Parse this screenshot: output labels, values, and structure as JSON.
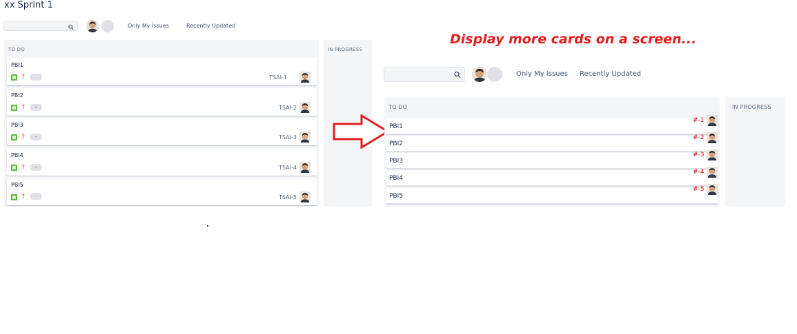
{
  "board": {
    "title": "xx Sprint 1"
  },
  "left_panel": {
    "search": {
      "value": "",
      "placeholder": ""
    },
    "filters": {
      "only_my_issues": "Only My Issues",
      "recently_updated": "Recently Updated"
    },
    "columns": {
      "todo": "TO DO",
      "in_progress": "IN PROGRESS"
    },
    "cards": [
      {
        "title": "PBI1",
        "estimate": "",
        "key": "TSAI-1"
      },
      {
        "title": "PBI2",
        "estimate": "-",
        "key": "TSAI-2"
      },
      {
        "title": "PBI3",
        "estimate": "-",
        "key": "TSAI-3"
      },
      {
        "title": "PBI4",
        "estimate": "-",
        "key": "TSAI-4"
      },
      {
        "title": "PBI5",
        "estimate": "",
        "key": "TSAI-5"
      }
    ]
  },
  "annotation": {
    "text": "Display more cards on a screen...",
    "arrow_color": "#e02020"
  },
  "right_panel": {
    "search": {
      "value": "",
      "placeholder": ""
    },
    "filters": {
      "only_my_issues": "Only My Issues",
      "recently_updated": "Recently Updated"
    },
    "columns": {
      "todo": "TO DO",
      "in_progress": "IN PROGRESS"
    },
    "cards": [
      {
        "title": "PBI1",
        "key": "#-1"
      },
      {
        "title": "PBI2",
        "key": "#-2"
      },
      {
        "title": "PBI3",
        "key": "#-3"
      },
      {
        "title": "PBI4",
        "key": "#-4"
      },
      {
        "title": "PBI5",
        "key": "#-5"
      }
    ]
  },
  "icons": {
    "search": "search-icon",
    "story": "story-icon",
    "priority": "arrow-up-icon",
    "avatar": "user-avatar"
  },
  "colors": {
    "story_green": "#63ba3c",
    "priority_orange": "#e97f33",
    "column_bg": "#f4f5f7",
    "annotation_red": "#e02020"
  }
}
